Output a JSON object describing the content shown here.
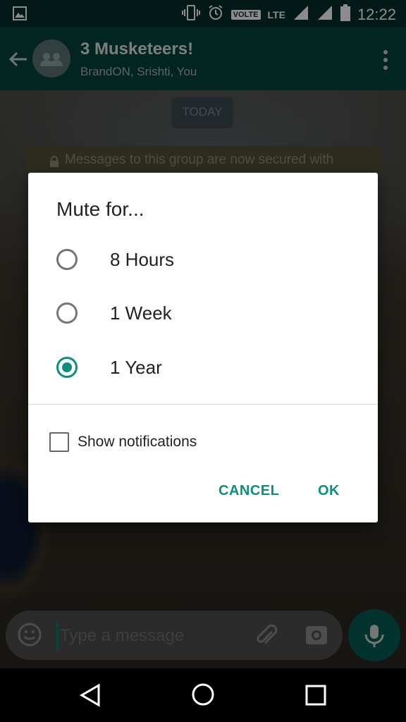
{
  "status_bar": {
    "time": "12:22",
    "volte_badge": "VOLTE",
    "network": "LTE",
    "icons": [
      "image-icon",
      "vibrate-icon",
      "alarm-icon",
      "signal-icon",
      "signal-icon",
      "battery-icon"
    ]
  },
  "app_bar": {
    "title": "3 Musketeers!",
    "subtitle": "BrandON, Srishti, You",
    "icons": [
      "back-arrow-icon",
      "group-avatar-icon",
      "more-vert-icon"
    ]
  },
  "chat": {
    "date_chip": "TODAY",
    "system_message": "Messages to this group are now secured with"
  },
  "input_bar": {
    "placeholder": "Type a message",
    "icons": [
      "emoji-icon",
      "attach-icon",
      "camera-icon",
      "mic-icon"
    ]
  },
  "dialog": {
    "title": "Mute for...",
    "options": [
      {
        "label": "8 Hours",
        "selected": false
      },
      {
        "label": "1 Week",
        "selected": false
      },
      {
        "label": "1 Year",
        "selected": true
      }
    ],
    "checkbox_label": "Show notifications",
    "checkbox_checked": false,
    "cancel_label": "CANCEL",
    "ok_label": "OK",
    "accent_color": "#0b8f7c"
  },
  "nav_bar": {
    "icons": [
      "nav-back-icon",
      "nav-home-icon",
      "nav-recents-icon"
    ]
  }
}
